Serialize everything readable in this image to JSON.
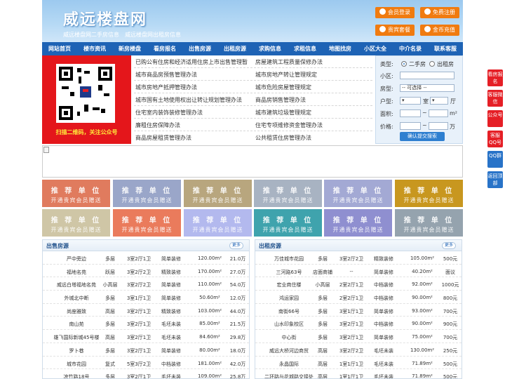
{
  "header": {
    "site_name": "威远楼盘网",
    "subtitle": "威远楼盘网二手房信息　威远楼盘网出租房信息",
    "buttons": [
      {
        "label": "会员登录",
        "icon": "user-icon"
      },
      {
        "label": "免费注册",
        "icon": "register-icon"
      },
      {
        "label": "贵宾套餐",
        "icon": "vip-icon"
      },
      {
        "label": "金币充值",
        "icon": "coin-icon"
      }
    ],
    "accent": "#f07b10"
  },
  "nav": [
    "网站首页",
    "楼市资讯",
    "新房楼盘",
    "看房报名",
    "出售房源",
    "出租房源",
    "求购信息",
    "求租信息",
    "地图找房",
    "小区大全",
    "中介名录",
    "联系客服"
  ],
  "qr": {
    "caption": "扫描二维码，关注公众号"
  },
  "links": {
    "left": [
      "已购公有住房和经济适用住房上市出售管理暂",
      "城市商品房预售管理办法",
      "城市房地产抵押管理办法",
      "城市国有土地使用权出让转让规划管理办法",
      "住宅室内装饰装修管理办法",
      "廉租住房保障办法",
      "商品房屋租赁管理办法"
    ],
    "right": [
      "房屋建筑工程质量保修办法",
      "城市房地产转让管理规定",
      "城市危险房屋管理规定",
      "商品房销售管理办法",
      "城市建筑垃圾管理规定",
      "住宅专项维修资金管理办法",
      "公共租赁住房管理办法"
    ]
  },
  "search": {
    "type_label": "类型:",
    "opt1": "二手房",
    "opt2": "出租房",
    "community_label": "小区:",
    "house_type_label": "房型:",
    "house_type_value": "-- 可选择 --",
    "layout_label": "户型:",
    "room_unit": "室",
    "hall_unit": "厅",
    "area_label": "面积:",
    "area_unit": "m²",
    "price_label": "价格:",
    "price_unit": "万",
    "submit": "确认提交搜索"
  },
  "ads": {
    "title": "推 荐 单 位",
    "sub": "开通贵宾会员赠送",
    "colors": [
      "#e07b5e",
      "#9aa6c9",
      "#b8a67e",
      "#a8b3c2",
      "#a3a9d4",
      "#c8971f",
      "#cfc6a6",
      "#ea7b5c",
      "#b3b9ee",
      "#3fa3ad",
      "#8f8fd0",
      "#95a3ae"
    ]
  },
  "sale": {
    "title": "出售房源",
    "more": "更多",
    "rows": [
      [
        "严中旁边",
        "多层",
        "3室2厅1卫",
        "简单装修",
        "120.00m²",
        "21.0万"
      ],
      [
        "福地名苑",
        "跃层",
        "3室2厅2卫",
        "精致装修",
        "170.00m²",
        "27.0万"
      ],
      [
        "威远白塔福地名苑",
        "小高层",
        "3室2厅2卫",
        "简单装修",
        "110.00m²",
        "54.0万"
      ],
      [
        "外城北中断",
        "多层",
        "3室1厅1卫",
        "简单装修",
        "50.60m²",
        "12.0万"
      ],
      [
        "尚座雅致",
        "高层",
        "3室2厅1卫",
        "精致装修",
        "103.00m²",
        "44.0万"
      ],
      [
        "南山苑",
        "多层",
        "3室2厅1卫",
        "毛坯未装",
        "85.00m²",
        "21.5万"
      ],
      [
        "雄飞国际新城45号楼",
        "高层",
        "3室2厅1卫",
        "毛坯未装",
        "84.60m²",
        "29.8万"
      ],
      [
        "罗卜巷",
        "多层",
        "3室2厅1卫",
        "简单装修",
        "80.00m²",
        "18.0万"
      ],
      [
        "城市花园",
        "复式",
        "5室3厅2卫",
        "中档装修",
        "181.00m²",
        "42.0万"
      ],
      [
        "凉竹路18号",
        "多层",
        "3室2厅1卫",
        "毛坯未装",
        "109.00m²",
        "25.8万"
      ]
    ]
  },
  "rent": {
    "title": "出租房源",
    "more": "更多",
    "rows": [
      [
        "万佳城市花园",
        "多层",
        "3室2厅2卫",
        "精致装修",
        "105.00m²",
        "500元"
      ],
      [
        "三河路63号",
        "店面商铺",
        "--",
        "简单装修",
        "40.20m²",
        "面议"
      ],
      [
        "宏业商住楼",
        "小高层",
        "2室2厅1卫",
        "中档装修",
        "92.00m²",
        "1000元"
      ],
      [
        "鸿运家园",
        "多层",
        "2室2厅1卫",
        "中档装修",
        "90.00m²",
        "800元"
      ],
      [
        "南街66号",
        "多层",
        "3室1厅1卫",
        "简单装修",
        "93.00m²",
        "700元"
      ],
      [
        "山水印象校区",
        "多层",
        "3室2厅1卫",
        "中档装修",
        "90.00m²",
        "900元"
      ],
      [
        "中心街",
        "多层",
        "3室2厅1卫",
        "简单装修",
        "75.00m²",
        "700元"
      ],
      [
        "威远大桥河边商贸",
        "高层",
        "3室2厅2卫",
        "毛坯未装",
        "130.00m²",
        "250元"
      ],
      [
        "永晶国际",
        "高层",
        "1室1厅1卫",
        "毛坯未装",
        "71.89m²",
        "500元"
      ],
      [
        "二环路与花城路交接处",
        "高层",
        "1室1厅1卫",
        "毛坯未装",
        "71.89m²",
        "500元"
      ]
    ]
  },
  "sidebar": [
    {
      "label": "看房报名",
      "color": "#e51f26"
    },
    {
      "label": "客服微信",
      "color": "#e51f26"
    },
    {
      "label": "公众号",
      "color": "#e51f26"
    },
    {
      "label": "客服QQ号",
      "color": "#e51f26"
    },
    {
      "label": "QQ群",
      "color": "#2873c8"
    },
    {
      "label": "返回顶部",
      "color": "#2873c8"
    }
  ]
}
